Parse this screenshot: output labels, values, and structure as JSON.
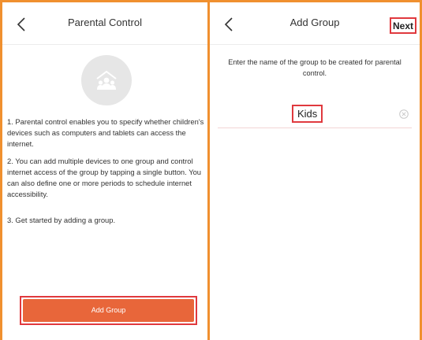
{
  "left_screen": {
    "title": "Parental Control",
    "back_icon": "chevron-left-icon",
    "illustration_icon": "group-house-icon",
    "paragraphs": [
      "1. Parental control enables you to specify whether children's devices such as computers and tablets can access the internet.",
      "2. You can add multiple devices to one group and control internet access of the group by tapping a single button. You can also define one or more periods to schedule internet accessibility.",
      "3. Get started by adding a group."
    ],
    "add_group_label": "Add Group"
  },
  "right_screen": {
    "title": "Add Group",
    "back_icon": "chevron-left-icon",
    "next_label": "Next",
    "instruction": "Enter the name of the group to be created for parental control.",
    "group_name_value": "Kids",
    "clear_icon": "clear-circle-icon"
  },
  "colors": {
    "frame_border": "#f0902f",
    "highlight_border": "#e0393e",
    "button_fill": "#e8663a",
    "illustration_bg": "#e6e6e6"
  }
}
